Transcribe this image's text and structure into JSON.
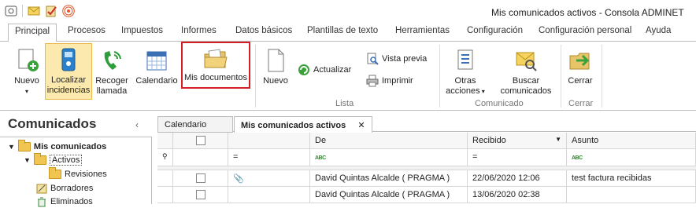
{
  "window": {
    "title": "Mis comunicados activos - Consola ADMINET"
  },
  "menu_tabs": [
    "Principal",
    "Procesos",
    "Impuestos",
    "Informes",
    "Datos básicos",
    "Plantillas de texto",
    "Herramientas",
    "Configuración",
    "Configuración personal",
    "Ayuda"
  ],
  "ribbon": {
    "nuevo": "Nuevo",
    "localizar": "Localizar",
    "incidencias": "incidencias",
    "recoger": "Recoger",
    "llamada": "llamada",
    "calendario": "Calendario",
    "mis_documentos": "Mis documentos",
    "nuevo2": "Nuevo",
    "actualizar": "Actualizar",
    "vista_previa": "Vista previa",
    "imprimir": "Imprimir",
    "otras": "Otras",
    "acciones": "acciones",
    "buscar": "Buscar",
    "comunicados": "comunicados",
    "cerrar": "Cerrar",
    "group_lista": "Lista",
    "group_comunicado": "Comunicado",
    "group_cerrar": "Cerrar"
  },
  "left_panel": {
    "title": "Comunicados",
    "tree": [
      "Mis comunicados",
      "Activos",
      "Revisiones",
      "Borradores",
      "Eliminados"
    ]
  },
  "doc_tabs": [
    "Calendario",
    "Mis comunicados activos"
  ],
  "grid": {
    "headers": {
      "de": "De",
      "recibido": "Recibido",
      "asunto": "Asunto"
    },
    "filter_eq": "=",
    "rows": [
      {
        "de": "David Quintas Alcalde ( PRAGMA )",
        "recibido": "22/06/2020 12:06",
        "asunto": "test factura recibidas"
      },
      {
        "de": "David Quintas Alcalde ( PRAGMA )",
        "recibido": "13/06/2020 02:38",
        "asunto": ""
      }
    ]
  },
  "colors": {
    "selected_bg": "#fce9ad",
    "outline_red": "#d32026"
  }
}
